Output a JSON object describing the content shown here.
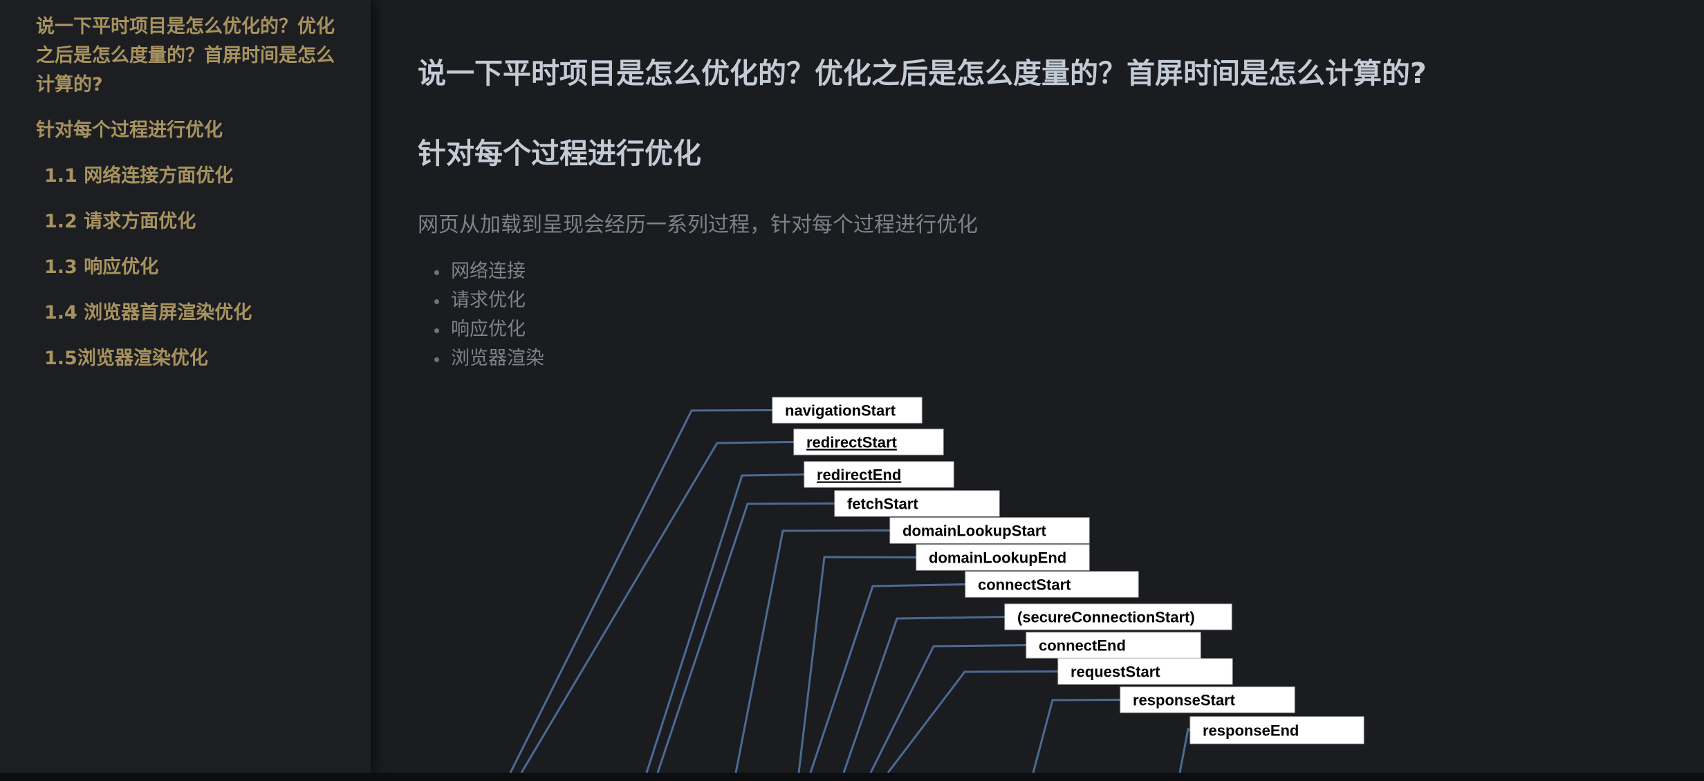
{
  "sidebar": {
    "items": [
      {
        "label": "说一下平时项目是怎么优化的？优化之后是怎么度量的？首屏时间是怎么计算的?"
      },
      {
        "label": "针对每个过程进行优化"
      },
      {
        "label": "1.1 网络连接方面优化"
      },
      {
        "label": "1.2 请求方面优化"
      },
      {
        "label": "1.3 响应优化"
      },
      {
        "label": "1.4 浏览器首屏渲染优化"
      },
      {
        "label": "1.5浏览器渲染优化"
      }
    ]
  },
  "main": {
    "title": "说一下平时项目是怎么优化的？优化之后是怎么度量的？首屏时间是怎么计算的?",
    "section_heading": "针对每个过程进行优化",
    "intro": "网页从加载到呈现会经历一系列过程，针对每个过程进行优化",
    "bullets": [
      "网络连接",
      "请求优化",
      "响应优化",
      "浏览器渲染"
    ]
  },
  "diagram": {
    "line_color": "#4d6a94",
    "label_bg": "#ffffff",
    "label_color": "#000000",
    "labels": [
      {
        "text": "navigationStart",
        "underline": false
      },
      {
        "text": "redirectStart",
        "underline": true
      },
      {
        "text": "redirectEnd",
        "underline": true
      },
      {
        "text": "fetchStart",
        "underline": false
      },
      {
        "text": "domainLookupStart",
        "underline": false
      },
      {
        "text": "domainLookupEnd",
        "underline": false
      },
      {
        "text": "connectStart",
        "underline": false
      },
      {
        "text": "(secureConnectionStart)",
        "underline": false
      },
      {
        "text": "connectEnd",
        "underline": false
      },
      {
        "text": "requestStart",
        "underline": false
      },
      {
        "text": "responseStart",
        "underline": false
      },
      {
        "text": "responseEnd",
        "underline": false
      }
    ]
  }
}
